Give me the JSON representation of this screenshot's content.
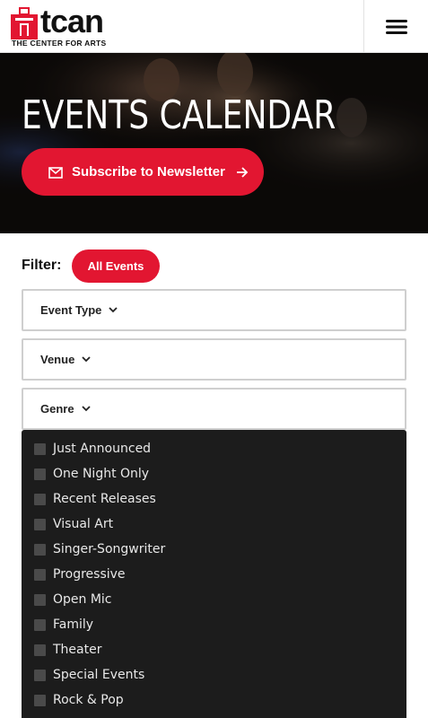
{
  "header": {
    "logo_word": "tcan",
    "logo_tagline": "THE CENTER FOR ARTS"
  },
  "hero": {
    "title": "EVENTS CALENDAR",
    "subscribe_label": "Subscribe to Newsletter"
  },
  "filter": {
    "label": "Filter:",
    "all_events_label": "All Events",
    "dropdowns": [
      "Event Type",
      "Venue",
      "Genre"
    ]
  },
  "genres": [
    "Just Announced",
    "One Night Only",
    "Recent Releases",
    "Visual Art",
    "Singer-Songwriter",
    "Progressive",
    "Open Mic",
    "Family",
    "Theater",
    "Special Events",
    "Rock & Pop"
  ],
  "colors": {
    "accent": "#e21631",
    "panel": "#1c1c1c",
    "checkbox": "#4a4a4a"
  },
  "icons": {
    "menu": "hamburger-icon",
    "mail": "mail-icon",
    "arrow": "arrow-right-icon",
    "chevron": "chevron-down-icon"
  }
}
